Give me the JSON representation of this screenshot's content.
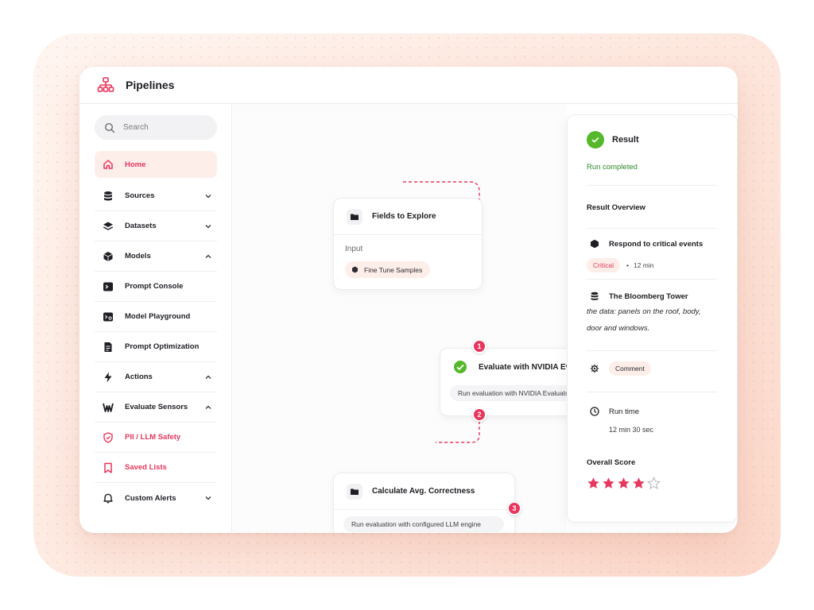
{
  "app": {
    "title": "Pipelines"
  },
  "search": {
    "placeholder": "Search"
  },
  "sidebar": {
    "items": [
      {
        "label": "Home",
        "icon": "home-icon",
        "active": true,
        "red": true,
        "chevron": ""
      },
      {
        "label": "Sources",
        "icon": "database-icon",
        "chevron": "down"
      },
      {
        "label": "Datasets",
        "icon": "layers-icon",
        "chevron": "down"
      },
      {
        "label": "Models",
        "icon": "cube-icon",
        "chevron": "up"
      },
      {
        "label": "Prompt Console",
        "icon": "terminal-icon",
        "chevron": ""
      },
      {
        "label": "Model Playground",
        "icon": "playground-icon",
        "chevron": ""
      },
      {
        "label": "Prompt Optimization",
        "icon": "document-icon",
        "chevron": ""
      },
      {
        "label": "Actions",
        "icon": "lightning-icon",
        "chevron": "up"
      },
      {
        "label": "Evaluate Sensors",
        "icon": "sensor-icon",
        "chevron": "up"
      },
      {
        "label": "PII / LLM Safety",
        "icon": "shield-icon",
        "red": true,
        "chevron": ""
      },
      {
        "label": "Saved Lists",
        "icon": "bookmark-icon",
        "red": true,
        "chevron": ""
      },
      {
        "label": "Custom Alerts",
        "icon": "bell-icon",
        "chevron": "down"
      }
    ]
  },
  "nodes": {
    "fields": {
      "title": "Fields to Explore",
      "input_label": "Input",
      "tag": "Fine Tune Samples"
    },
    "evaluate": {
      "title": "Evaluate with NVIDIA Evaluator",
      "description": "Run evaluation with NVIDIA Evaluator"
    },
    "calculate": {
      "title": "Calculate Avg. Correctness",
      "description": "Run evaluation with configured LLM engine"
    },
    "badges": [
      "1",
      "2",
      "3"
    ]
  },
  "result": {
    "title": "Result",
    "status": "Run completed",
    "overview_label": "Result Overview",
    "event": {
      "title": "Respond to critical events",
      "severity": "Critical",
      "time": "12 min"
    },
    "source": {
      "title": "The Bloomberg Tower",
      "text": "the data: panels on the roof, body, door and windows."
    },
    "comment_label": "Comment",
    "runtime": {
      "label": "Run time",
      "value": "12 min 30 sec"
    },
    "score": {
      "label": "Overall Score",
      "rating": 4,
      "max": 5
    }
  },
  "colors": {
    "accent": "#e8365d",
    "success": "#55b82b",
    "accent_bg": "#fdeeea"
  }
}
